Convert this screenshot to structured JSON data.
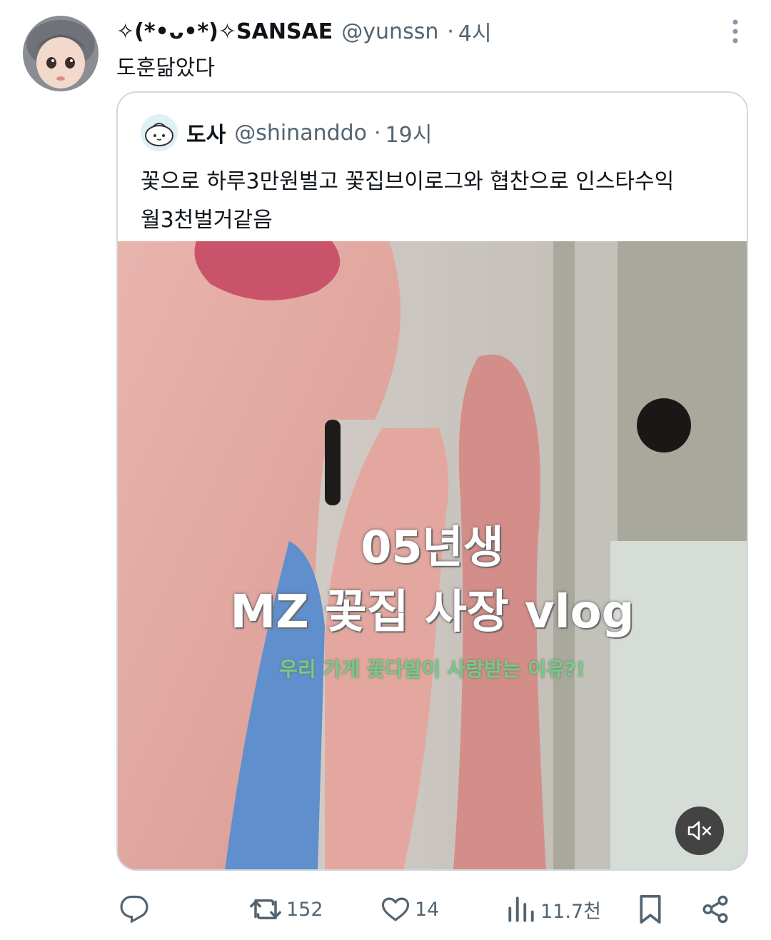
{
  "tweet": {
    "display_name": "✧(*•ᴗ•*)✧SANSAE",
    "handle": "@yunssn",
    "separator": "·",
    "time": "4시",
    "text": "도훈닮았다",
    "avatar_icon": "doll-avatar"
  },
  "quoted": {
    "display_name": "도사",
    "handle": "@shinanddo",
    "separator": "·",
    "time": "19시",
    "text_lines": [
      "꽃으로 하루3만원벌고 꽃집브이로그와 협찬으로 인스타수익",
      "월3천벌거같음"
    ],
    "avatar_icon": "cartoon-bun-avatar",
    "media": {
      "overlay_line1": "05년생",
      "overlay_line2": "MZ 꽃집 사장 vlog",
      "overlay_line3": "우리 가게 꽃다발이 사랑받는 이유?!",
      "mute_icon": "speaker-muted-icon"
    }
  },
  "actions": {
    "reply": {
      "icon": "reply-icon",
      "count": ""
    },
    "retweet": {
      "icon": "retweet-icon",
      "count": "152"
    },
    "like": {
      "icon": "heart-icon",
      "count": "14"
    },
    "views": {
      "icon": "views-icon",
      "count": "11.7천"
    },
    "bookmark": {
      "icon": "bookmark-icon"
    },
    "share": {
      "icon": "share-icon"
    }
  },
  "colors": {
    "text_primary": "#0f1419",
    "text_secondary": "#536471",
    "border": "#cfd9de"
  }
}
